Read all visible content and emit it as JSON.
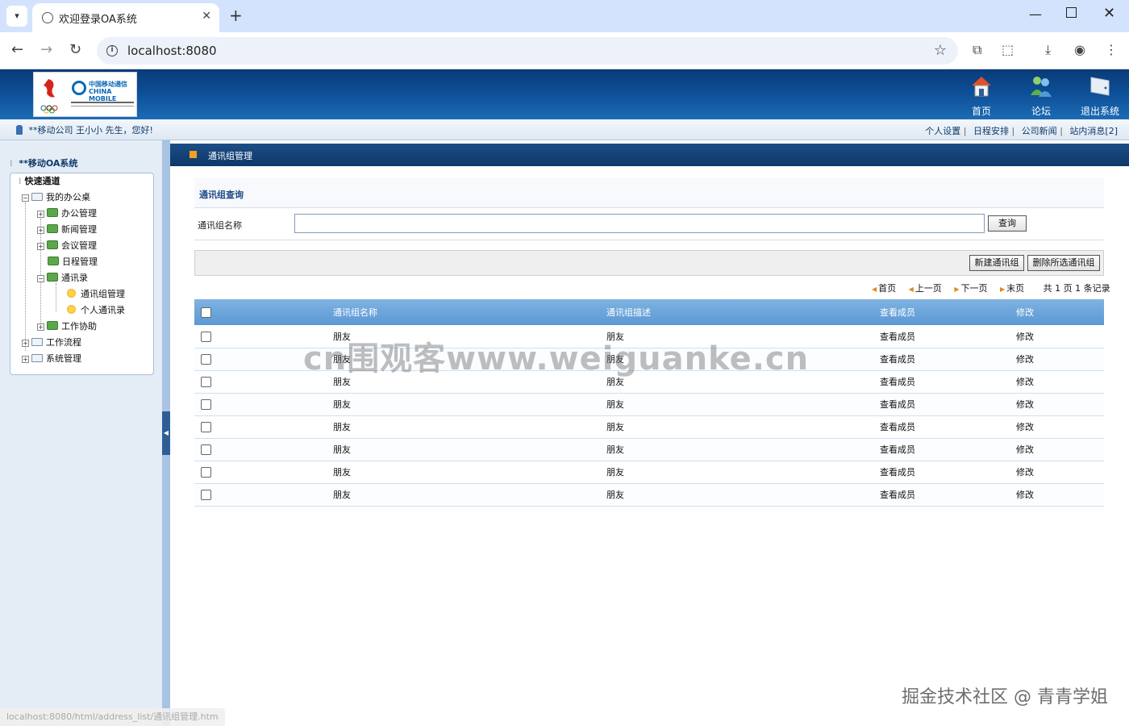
{
  "browser": {
    "tab_title": "欢迎登录OA系统",
    "url": "localhost:8080",
    "status_url": "localhost:8080/html/address_list/通讯组管理.htm"
  },
  "header": {
    "nav": [
      {
        "label": "首页",
        "icon": "home-icon"
      },
      {
        "label": "论坛",
        "icon": "forum-users-icon"
      },
      {
        "label": "退出系统",
        "icon": "logout-icon"
      }
    ],
    "logo_cn": "中国移动通信",
    "logo_en": "CHINA MOBILE"
  },
  "infobar": {
    "greeting": "**移动公司 王小小 先生，您好!",
    "links": [
      "个人设置",
      "日程安排",
      "公司新闻",
      "站内消息[2]"
    ]
  },
  "sidebar": {
    "title": "**移动OA系统",
    "quick": "快速通道",
    "tree": {
      "desk": "我的办公桌",
      "office": "办公管理",
      "news": "新闻管理",
      "meeting": "会议管理",
      "schedule": "日程管理",
      "contacts": "通讯录",
      "group_mgmt": "通讯组管理",
      "personal_contacts": "个人通讯录",
      "assist": "工作协助",
      "workflow": "工作流程",
      "system": "系统管理"
    }
  },
  "main": {
    "page_title": "通讯组管理",
    "section_title": "通讯组查询",
    "search_label": "通讯组名称",
    "search_value": "",
    "query_button": "查询",
    "new_button": "新建通讯组",
    "delete_button": "删除所选通讯组",
    "pager": {
      "first": "首页",
      "prev": "上一页",
      "next": "下一页",
      "last": "末页",
      "summary": "共 1 页 1 条记录"
    },
    "table": {
      "headers": [
        "通讯组名称",
        "通讯组描述",
        "查看成员",
        "修改"
      ],
      "rows": [
        {
          "name": "朋友",
          "desc": "朋友",
          "view": "查看成员",
          "edit": "修改"
        },
        {
          "name": "朋友",
          "desc": "朋友",
          "view": "查看成员",
          "edit": "修改"
        },
        {
          "name": "朋友",
          "desc": "朋友",
          "view": "查看成员",
          "edit": "修改"
        },
        {
          "name": "朋友",
          "desc": "朋友",
          "view": "查看成员",
          "edit": "修改"
        },
        {
          "name": "朋友",
          "desc": "朋友",
          "view": "查看成员",
          "edit": "修改"
        },
        {
          "name": "朋友",
          "desc": "朋友",
          "view": "查看成员",
          "edit": "修改"
        },
        {
          "name": "朋友",
          "desc": "朋友",
          "view": "查看成员",
          "edit": "修改"
        },
        {
          "name": "朋友",
          "desc": "朋友",
          "view": "查看成员",
          "edit": "修改"
        }
      ]
    }
  },
  "watermarks": {
    "center": "cn围观客www.weiguanke.cn",
    "bottom_right": "掘金技术社区 @ 青青学姐"
  },
  "colors": {
    "header_blue": "#0d4e95",
    "table_header": "#5b98d3",
    "link_blue": "#1f5fb0",
    "accent_orange": "#f5a020"
  }
}
